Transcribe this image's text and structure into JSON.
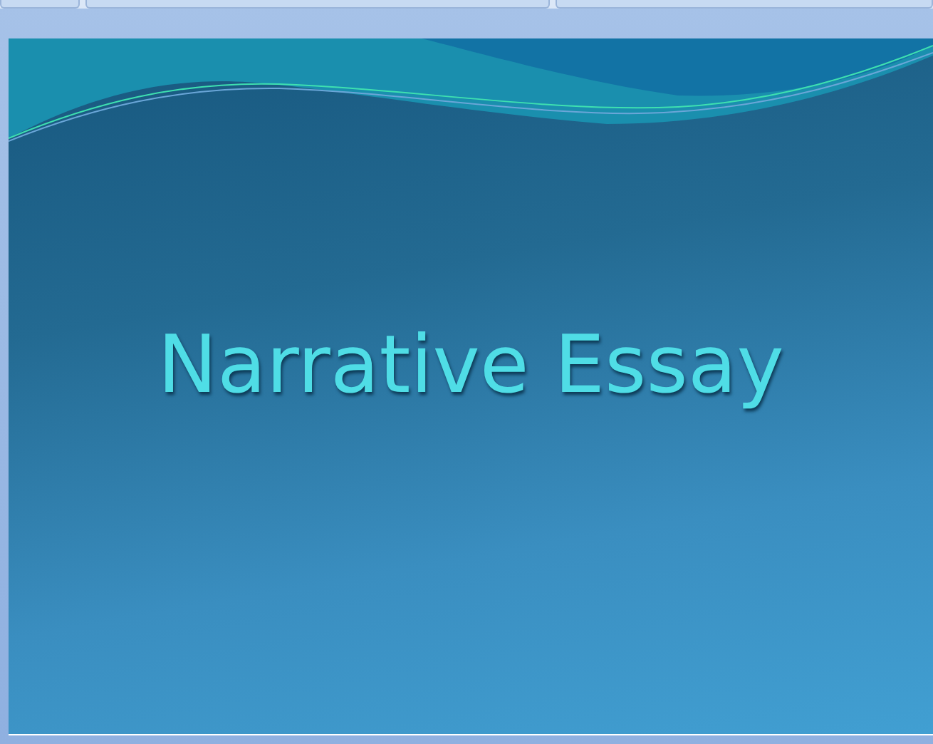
{
  "slide": {
    "title": "Narrative Essay"
  }
}
